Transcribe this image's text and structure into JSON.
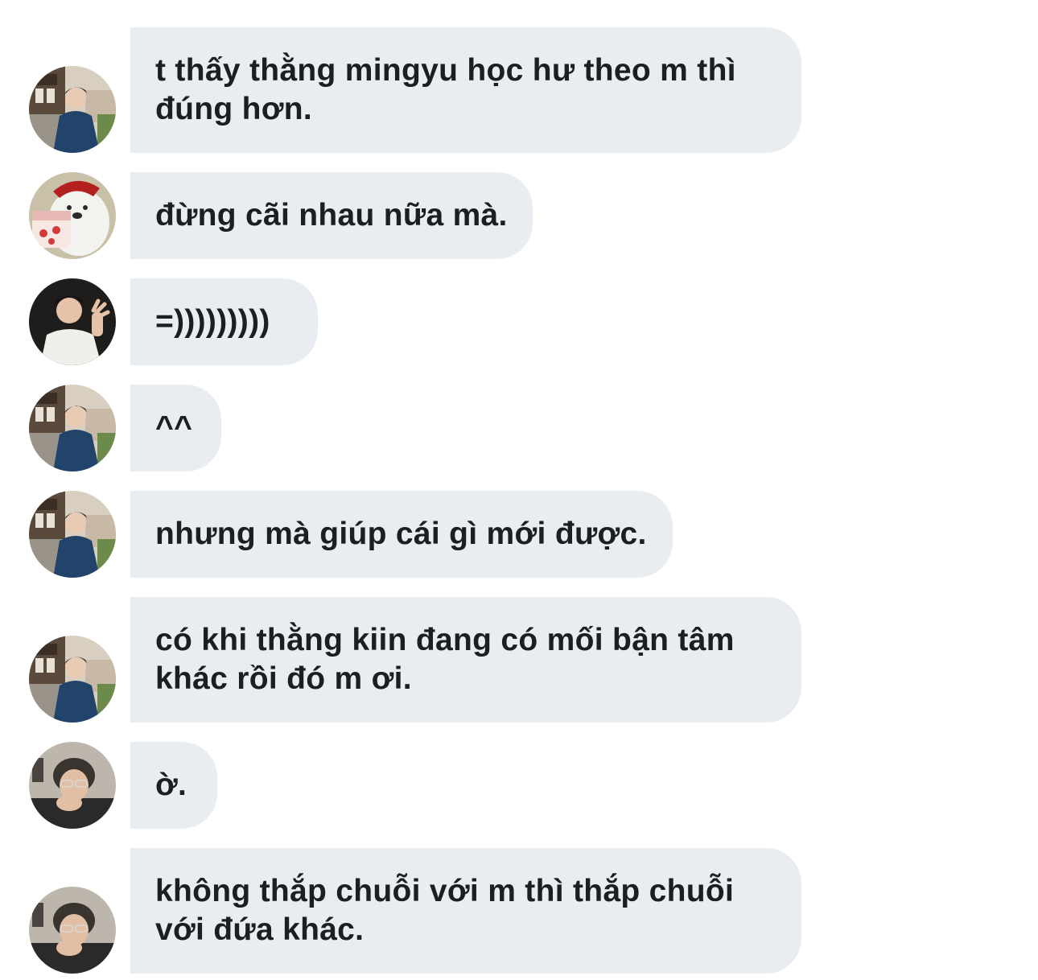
{
  "messages": [
    {
      "text": "t thấy thằng mingyu học hư theo m thì đúng hơn.",
      "avatar": "user-a-avatar"
    },
    {
      "text": "đừng cãi nhau nữa mà.",
      "avatar": "bear-avatar"
    },
    {
      "text": "=)))))))))",
      "avatar": "user-b-avatar"
    },
    {
      "text": "^^",
      "avatar": "user-a-avatar"
    },
    {
      "text": "nhưng mà giúp cái gì mới được.",
      "avatar": "user-a-avatar"
    },
    {
      "text": "có khi thằng kiin đang có mối bận tâm khác rồi đó m ơi.",
      "avatar": "user-a-avatar"
    },
    {
      "text": "ờ.",
      "avatar": "user-c-avatar"
    },
    {
      "text": "không thắp chuỗi với m thì thắp chuỗi với đứa khác.",
      "avatar": "user-c-avatar"
    }
  ],
  "colors": {
    "bubble_bg": "#e9ecf0",
    "text": "#1c1e21",
    "page_bg": "#ffffff"
  }
}
